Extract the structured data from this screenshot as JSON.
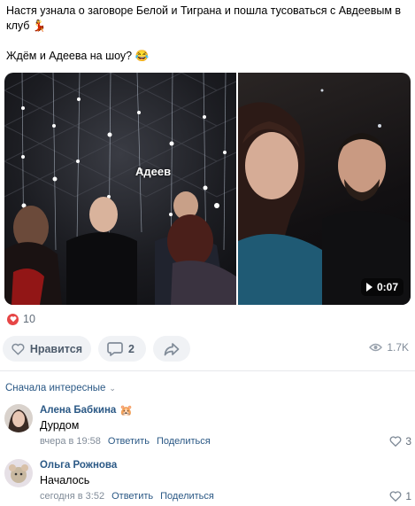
{
  "post": {
    "text_line1": "Настя узнала о заговоре Белой и Тиграна и пошла тусоваться с Авдеевым в клуб 💃",
    "text_line2": "Ждём и Адеева на шоу? 😂"
  },
  "media": {
    "photo_caption": "Адеев",
    "video_duration": "0:07"
  },
  "reactions": {
    "count": "10",
    "color": "#e64646"
  },
  "actions": {
    "like_label": "Нравится",
    "comments_count": "2",
    "views": "1.7K"
  },
  "comments_section": {
    "sort_label": "Сначала интересные"
  },
  "comments": [
    {
      "author": "Алена Бабкина",
      "badge": "🐹",
      "text": "Дурдом",
      "time": "вчера в 19:58",
      "reply_label": "Ответить",
      "share_label": "Поделиться",
      "likes": "3"
    },
    {
      "author": "Ольга Рожнова",
      "text": "Началось",
      "time": "сегодня в 3:52",
      "reply_label": "Ответить",
      "share_label": "Поделиться",
      "likes": "1"
    }
  ],
  "colors": {
    "link": "#2a5885",
    "muted": "#818c99",
    "pill_bg": "#f0f2f5"
  }
}
